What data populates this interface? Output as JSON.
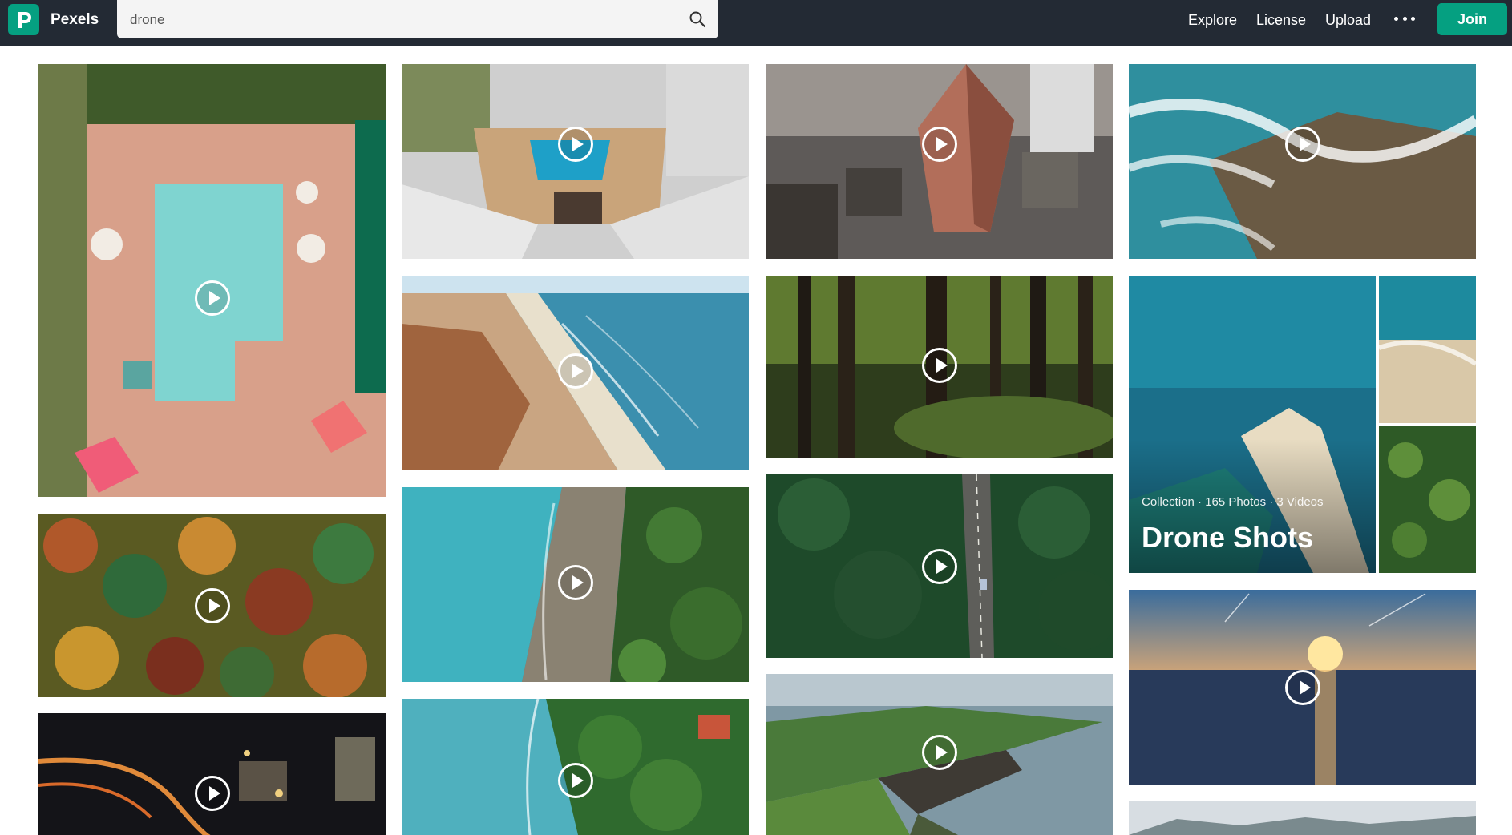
{
  "topbar": {
    "brand": "Pexels",
    "logo_icon": "pexels-logo-icon",
    "search_value": "drone",
    "search_icon": "search-icon",
    "nav": [
      "Explore",
      "License",
      "Upload"
    ],
    "more_icon": "more-horizontal-icon",
    "join_label": "Join",
    "accent_color": "#05a081"
  },
  "results": {
    "tiles": [
      {
        "subject": "hotel pool",
        "kind": "video"
      },
      {
        "subject": "autumn forest",
        "kind": "video"
      },
      {
        "subject": "city night",
        "kind": "video"
      },
      {
        "subject": "tower pool",
        "kind": "video"
      },
      {
        "subject": "coastline dunes",
        "kind": "video"
      },
      {
        "subject": "rocky shore",
        "kind": "video"
      },
      {
        "subject": "tropical coast",
        "kind": "video"
      },
      {
        "subject": "skyscraper",
        "kind": "video"
      },
      {
        "subject": "redwood forest",
        "kind": "video"
      },
      {
        "subject": "forest road",
        "kind": "video"
      },
      {
        "subject": "sea cliffs",
        "kind": "video"
      },
      {
        "subject": "ocean waves",
        "kind": "video"
      },
      {
        "subject": "sunset sea",
        "kind": "video"
      }
    ],
    "collection": {
      "meta": "Collection · 165 Photos · 3 Videos",
      "title": "Drone Shots"
    }
  }
}
